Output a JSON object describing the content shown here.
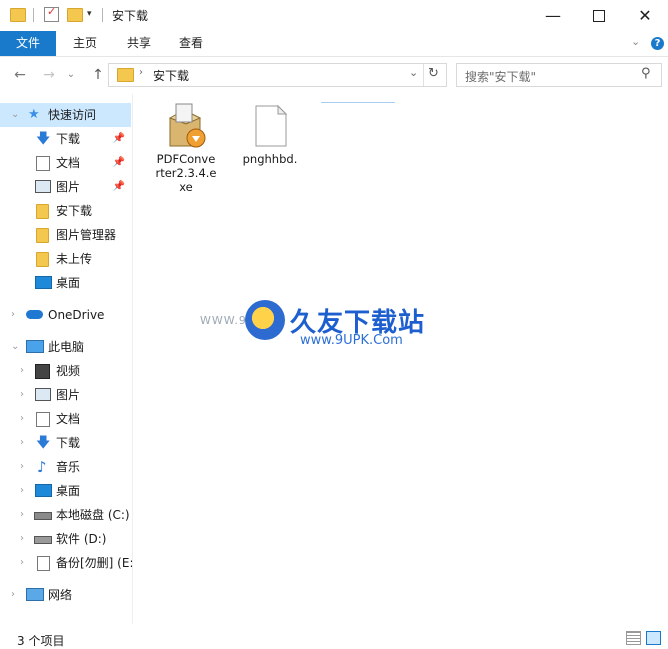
{
  "window": {
    "title": "安下载"
  },
  "ribbon": {
    "tabs": [
      "文件",
      "主页",
      "共享",
      "查看"
    ]
  },
  "address": {
    "path": "安下载"
  },
  "search": {
    "placeholder": "搜索\"安下载\""
  },
  "sidebar": {
    "quick_access": {
      "label": "快速访问",
      "items": [
        {
          "label": "下载",
          "pinned": true
        },
        {
          "label": "文档",
          "pinned": true
        },
        {
          "label": "图片",
          "pinned": true
        },
        {
          "label": "安下载",
          "pinned": false
        },
        {
          "label": "图片管理器",
          "pinned": false
        },
        {
          "label": "未上传",
          "pinned": false
        },
        {
          "label": "桌面",
          "pinned": false
        }
      ]
    },
    "onedrive": {
      "label": "OneDrive"
    },
    "this_pc": {
      "label": "此电脑",
      "items": [
        "视频",
        "图片",
        "文档",
        "下载",
        "音乐",
        "桌面",
        "本地磁盘 (C:)",
        "软件 (D:)",
        "备份[勿删] (E:"
      ]
    },
    "network": {
      "label": "网络"
    }
  },
  "files": [
    {
      "name": "PDFConverter2.3.4.exe",
      "lines": [
        "PDFConve",
        "rter2.3.4.e",
        "xe"
      ],
      "icon": "installer-icon"
    },
    {
      "name": "pnghhbd.",
      "lines": [
        "pnghhbd."
      ],
      "icon": "blank-file-icon"
    }
  ],
  "watermark": {
    "brand": "久友下载站",
    "url_left": "WWW.9U",
    "url_right": "www.9UPK.Com"
  },
  "status": {
    "count": "3 个项目"
  },
  "colors": {
    "accent": "#1979ca",
    "selected": "#cce8ff",
    "folder": "#f4c74f"
  }
}
